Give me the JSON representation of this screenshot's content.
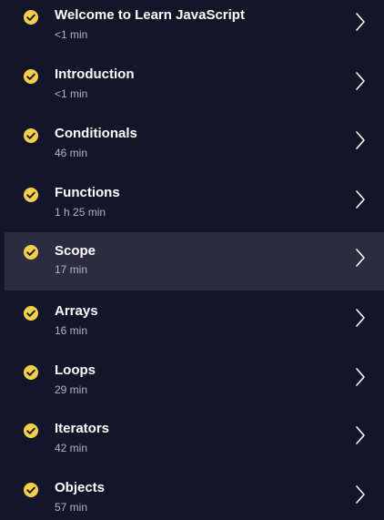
{
  "lessons": [
    {
      "title": "Welcome to Learn JavaScript",
      "duration": "<1 min",
      "status_icon": "check-circle-icon",
      "nav_icon": "chevron-right-icon"
    },
    {
      "title": "Introduction",
      "duration": "<1 min",
      "status_icon": "check-circle-icon",
      "nav_icon": "chevron-right-icon"
    },
    {
      "title": "Conditionals",
      "duration": "46 min",
      "status_icon": "check-circle-icon",
      "nav_icon": "chevron-right-icon"
    },
    {
      "title": "Functions",
      "duration": "1 h 25 min",
      "status_icon": "check-circle-icon",
      "nav_icon": "chevron-right-icon"
    },
    {
      "title": "Scope",
      "duration": "17 min",
      "status_icon": "check-circle-icon",
      "nav_icon": "chevron-right-icon",
      "active": true
    },
    {
      "title": "Arrays",
      "duration": "16 min",
      "status_icon": "check-circle-icon",
      "nav_icon": "chevron-right-icon"
    },
    {
      "title": "Loops",
      "duration": "29 min",
      "status_icon": "check-circle-icon",
      "nav_icon": "chevron-right-icon"
    },
    {
      "title": "Iterators",
      "duration": "42 min",
      "status_icon": "check-circle-icon",
      "nav_icon": "chevron-right-icon"
    },
    {
      "title": "Objects",
      "duration": "57 min",
      "status_icon": "check-circle-icon",
      "nav_icon": "chevron-right-icon"
    }
  ],
  "colors": {
    "background": "#13152a",
    "active_row": "#2a2d41",
    "check": "#f5cf47",
    "title": "#ffffff",
    "duration": "#b3b6c6",
    "chevron": "#ffffff"
  }
}
